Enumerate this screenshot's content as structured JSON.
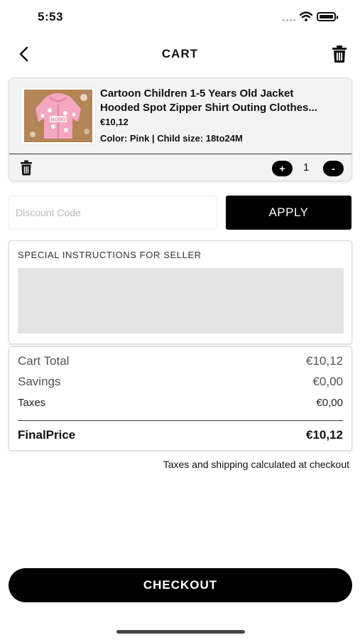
{
  "status_bar": {
    "time": "5:53"
  },
  "header": {
    "title": "CART",
    "back_icon": "chevron-left-icon",
    "delete_icon": "trash-icon"
  },
  "cart_item": {
    "title_line1": "Cartoon Children 1-5 Years Old Jacket",
    "title_line2": "Hooded Spot Zipper Shirt Outing Clothes...",
    "price": "€10,12",
    "variant": "Color: Pink | Child size: 18to24M",
    "quantity": "1",
    "left_button_label": "+",
    "right_button_label": "-",
    "image": "pink-hooded-jacket-photo",
    "image_lettering": "BOBO"
  },
  "discount": {
    "placeholder": "Discount Code",
    "apply_label": "APPLY"
  },
  "instructions": {
    "label": "SPECIAL INSTRUCTIONS FOR SELLER"
  },
  "totals": {
    "cart_total_label": "Cart Total",
    "cart_total_value": "€10,12",
    "savings_label": "Savings",
    "savings_value": "€0,00",
    "taxes_label": "Taxes",
    "taxes_value": "€0,00",
    "final_label": "FinalPrice",
    "final_value": "€10,12"
  },
  "shipping_note": "Taxes and shipping calculated at checkout",
  "checkout": {
    "label": "CHECKOUT"
  },
  "colors": {
    "primary": "#000000",
    "card_background": "#f3f3f3",
    "input_fill": "#e3e3e3",
    "product_pink": "#f4a7c0",
    "product_background": "#b98a5c"
  }
}
